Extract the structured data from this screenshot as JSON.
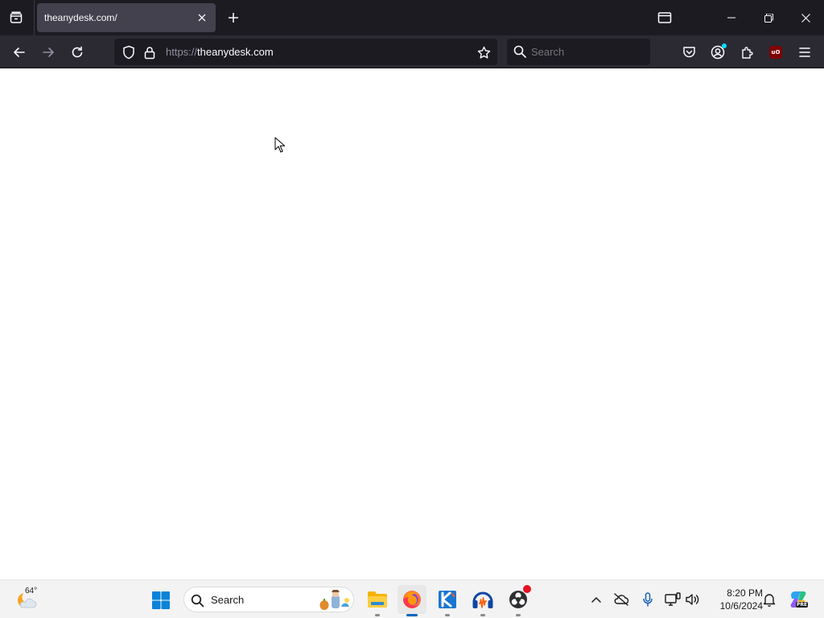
{
  "browser": {
    "tab": {
      "title": "theanydesk.com/"
    },
    "url": {
      "scheme": "https://",
      "host": "theanydesk.com"
    },
    "search": {
      "placeholder": "Search"
    },
    "toolbar": {
      "ublock_badge": "uO"
    }
  },
  "taskbar": {
    "weather": {
      "temp": "64°"
    },
    "search": {
      "label": "Search"
    },
    "apps": [
      {
        "name": "file-explorer",
        "running": true,
        "active": false
      },
      {
        "name": "firefox",
        "running": true,
        "active": true
      },
      {
        "name": "k-app",
        "running": true,
        "active": false
      },
      {
        "name": "audacity",
        "running": true,
        "active": false
      },
      {
        "name": "obs-studio",
        "running": true,
        "active": false
      }
    ],
    "clock": {
      "time": "8:20 PM",
      "date": "10/6/2024"
    },
    "copilot_badge": "PRE"
  },
  "colors": {
    "titlebar": "#1c1b22",
    "navbar": "#2b2a33",
    "active_tab": "#42414d",
    "taskbar": "#f3f3f3",
    "accent": "#0067c0"
  }
}
